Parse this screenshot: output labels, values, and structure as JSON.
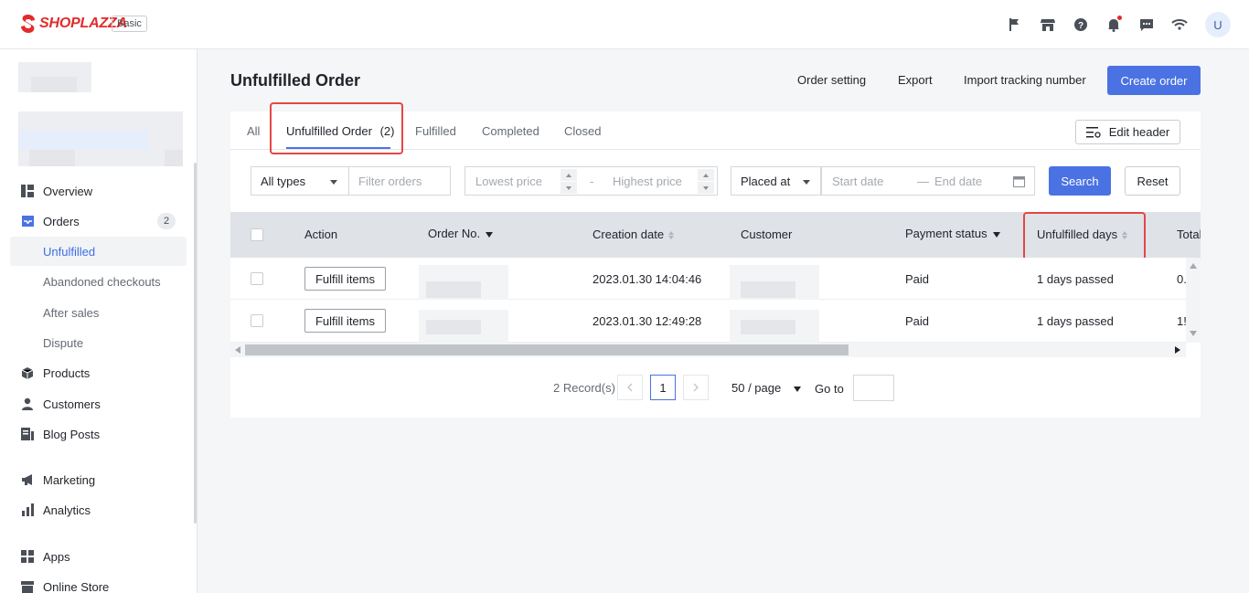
{
  "brand": {
    "name": "SHOPLAZZA",
    "plan": "Basic",
    "color": "#e32b2b"
  },
  "topbar": {
    "icons": [
      "flag-icon",
      "store-icon",
      "help-icon",
      "bell-icon",
      "chat-icon",
      "wifi-icon"
    ],
    "avatar_initial": "U"
  },
  "sidebar": {
    "items": [
      {
        "label": "Overview",
        "icon": "overview-icon"
      },
      {
        "label": "Orders",
        "icon": "orders-icon",
        "badge": "2"
      },
      {
        "label": "Products",
        "icon": "products-icon"
      },
      {
        "label": "Customers",
        "icon": "customers-icon"
      },
      {
        "label": "Blog Posts",
        "icon": "blog-icon"
      },
      {
        "label": "Marketing",
        "icon": "marketing-icon"
      },
      {
        "label": "Analytics",
        "icon": "analytics-icon"
      },
      {
        "label": "Apps",
        "icon": "apps-icon"
      },
      {
        "label": "Online Store",
        "icon": "store-icon"
      }
    ],
    "order_subitems": [
      "Unfulfilled",
      "Abandoned checkouts",
      "After sales",
      "Dispute"
    ],
    "active_subitem": "Unfulfilled"
  },
  "header": {
    "title": "Unfulfilled Order",
    "order_setting": "Order setting",
    "export": "Export",
    "import_tracking": "Import tracking number",
    "create_order": "Create order"
  },
  "tabs": {
    "all": "All",
    "unfulfilled": "Unfulfilled Order",
    "unfulfilled_count": "(2)",
    "fulfilled": "Fulfilled",
    "completed": "Completed",
    "closed": "Closed",
    "edit_header": "Edit header"
  },
  "filters": {
    "type_value": "All types",
    "filter_placeholder": "Filter orders",
    "lowest_price_placeholder": "Lowest price",
    "price_sep": "-",
    "highest_price_placeholder": "Highest price",
    "date_field_value": "Placed at",
    "start_date_placeholder": "Start date",
    "date_sep": "—",
    "end_date_placeholder": "End date",
    "search": "Search",
    "reset": "Reset"
  },
  "table": {
    "columns": {
      "action": "Action",
      "order_no": "Order No.",
      "creation_date": "Creation date",
      "customer": "Customer",
      "payment_status": "Payment status",
      "unfulfilled_days": "Unfulfilled days",
      "total": "Total"
    },
    "rows": [
      {
        "action": "Fulfill items",
        "creation_date": "2023.01.30 14:04:46",
        "payment_status": "Paid",
        "unfulfilled_days": "1 days passed",
        "total": "0."
      },
      {
        "action": "Fulfill items",
        "creation_date": "2023.01.30 12:49:28",
        "payment_status": "Paid",
        "unfulfilled_days": "1 days passed",
        "total": "1!"
      }
    ]
  },
  "pagination": {
    "records": "2 Record(s)",
    "current_page": "1",
    "page_size": "50 / page",
    "goto_label": "Go to"
  },
  "colors": {
    "accent": "#4a72e3",
    "highlight": "#e34747"
  }
}
